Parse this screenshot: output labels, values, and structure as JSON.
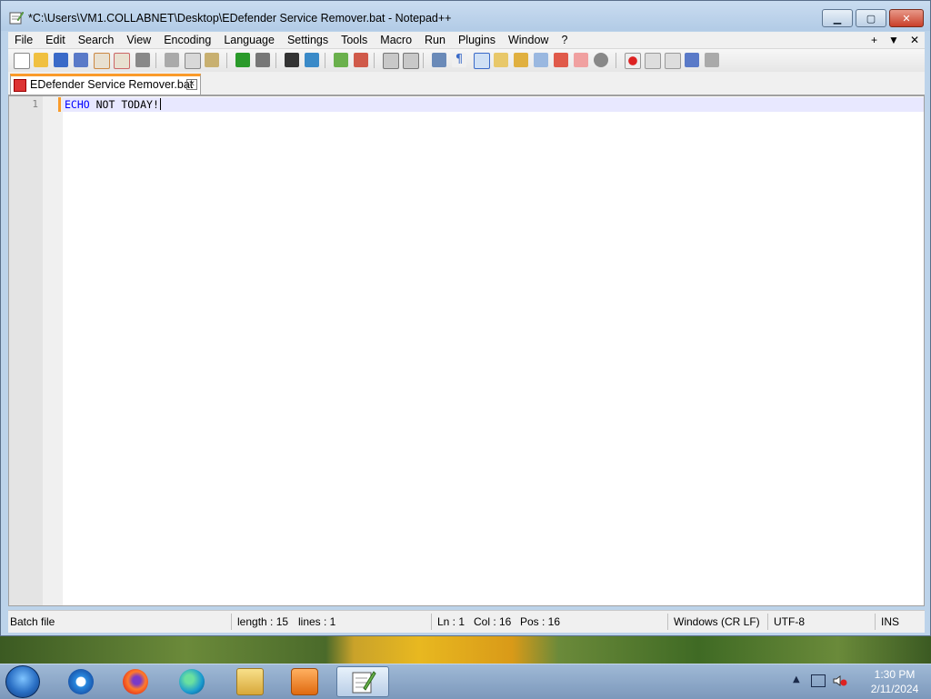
{
  "window": {
    "title": "*C:\\Users\\VM1.COLLABNET\\Desktop\\EDefender Service Remover.bat - Notepad++",
    "minimize_glyph": "▁",
    "maximize_glyph": "▢",
    "close_glyph": "✕"
  },
  "menu": {
    "items": [
      "File",
      "Edit",
      "Search",
      "View",
      "Encoding",
      "Language",
      "Settings",
      "Tools",
      "Macro",
      "Run",
      "Plugins",
      "Window",
      "?"
    ],
    "right": [
      "+",
      "▼",
      "✕"
    ]
  },
  "tab": {
    "label": "EDefender Service Remover.bat",
    "close_glyph": "✕"
  },
  "editor": {
    "line_number": "1",
    "keyword": "ECHO",
    "rest": " NOT TODAY!",
    "keyword_color": "#0000ff"
  },
  "status": {
    "file_type": "Batch file",
    "length": "length : 15",
    "lines": "lines : 1",
    "ln": "Ln : 1",
    "col": "Col : 16",
    "pos": "Pos : 16",
    "eol": "Windows (CR LF)",
    "encoding": "UTF-8",
    "mode": "INS"
  },
  "taskbar": {
    "icons": [
      "start-orb-icon",
      "internet-explorer-icon",
      "firefox-icon",
      "edge-icon",
      "file-explorer-icon",
      "media-player-icon",
      "notepad-plus-plus-icon"
    ],
    "time": "1:30 PM",
    "date": "2/11/2024"
  },
  "accent_colors": {
    "tab_highlight": "#fa9b2a",
    "current_line": "#e8e8ff"
  }
}
